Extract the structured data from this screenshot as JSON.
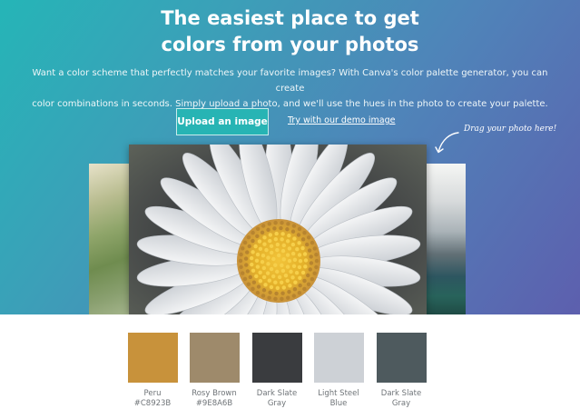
{
  "hero": {
    "title_line1": "The easiest place to get",
    "title_line2": "colors from your photos",
    "subtitle_line1": "Want a color scheme that perfectly matches your favorite images? With Canva's color palette generator, you can create",
    "subtitle_line2": "color combinations in seconds. Simply upload a photo, and we'll use the hues in the photo to create your palette.",
    "upload_button": "Upload an image",
    "demo_link": "Try with our demo image",
    "drag_note": "Drag your photo here!"
  },
  "palette": [
    {
      "name": "Peru",
      "hex": "#C8923B"
    },
    {
      "name": "Rosy Brown",
      "hex": "#9E8A6B"
    },
    {
      "name": "Dark Slate",
      "name2": "Gray",
      "hex": "#3A3C3F"
    },
    {
      "name": "Light Steel",
      "name2": "Blue",
      "hex": "#CDD1D6"
    },
    {
      "name": "Dark Slate",
      "name2": "Gray",
      "hex": "#4E5A5E"
    }
  ],
  "colors": {
    "accent_button": "#27b4b4",
    "hero_gradient_start": "#25b5b7",
    "hero_gradient_end": "#5d5fae"
  },
  "icons": {
    "arrow": "curved-arrow-icon"
  }
}
